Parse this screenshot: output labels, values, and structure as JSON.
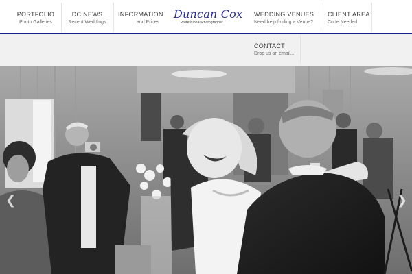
{
  "nav": {
    "portfolio": {
      "title": "PORTFOLIO",
      "subtitle": "Photo Galleries"
    },
    "dc_news": {
      "title": "DC NEWS",
      "subtitle": "Recent Weddings"
    },
    "information": {
      "title": "INFORMATION",
      "subtitle": "and Prices"
    },
    "wedding_venues": {
      "title": "WEDDING VENUES",
      "subtitle": "Need help finding a Venue?"
    },
    "client_area": {
      "title": "CLIENT AREA",
      "subtitle": "Code Needed"
    },
    "contact": {
      "title": "CONTACT",
      "subtitle": "Drop us an email..."
    }
  },
  "logo": {
    "name": "Duncan Cox",
    "tagline": "Professional Photographer"
  },
  "hero": {
    "slide_prev_icon": "chevron-left-icon",
    "slide_next_icon": "chevron-right-icon",
    "tone": "black-and-white"
  },
  "colors": {
    "accent": "#1b1f8a",
    "logo": "#2a2f8c"
  }
}
